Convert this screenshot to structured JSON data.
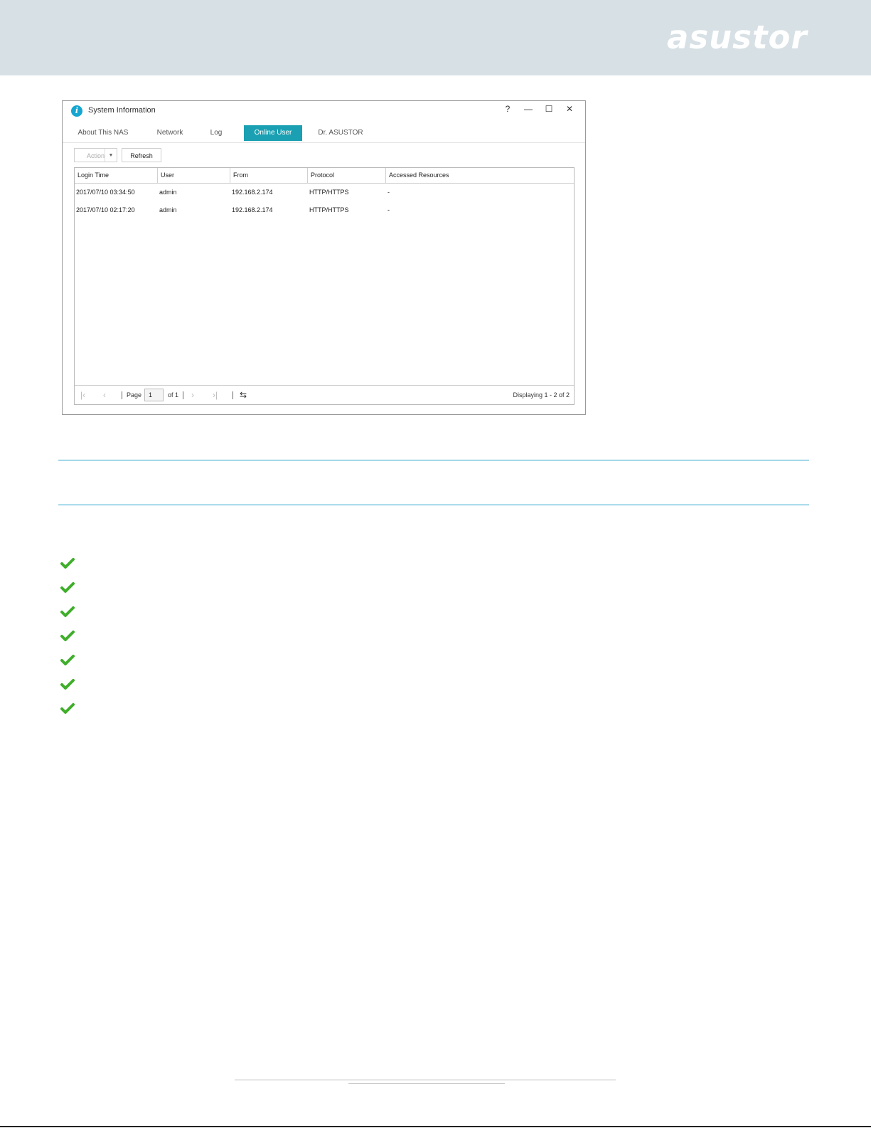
{
  "brand": {
    "logo_text": "asustor"
  },
  "window": {
    "title": "System Information",
    "controls": {
      "help": "?",
      "minimize": "—",
      "maximize": "☐",
      "close": "✕"
    },
    "tabs": [
      {
        "label": "About This NAS",
        "active": false
      },
      {
        "label": "Network",
        "active": false
      },
      {
        "label": "Log",
        "active": false
      },
      {
        "label": "Online User",
        "active": true
      },
      {
        "label": "Dr. ASUSTOR",
        "active": false
      }
    ],
    "toolbar": {
      "action_label": "Action",
      "refresh_label": "Refresh"
    },
    "table": {
      "columns": [
        "Login Time",
        "User",
        "From",
        "Protocol",
        "Accessed Resources"
      ],
      "rows": [
        [
          "2017/07/10 03:34:50",
          "admin",
          "192.168.2.174",
          "HTTP/HTTPS",
          "-"
        ],
        [
          "2017/07/10 02:17:20",
          "admin",
          "192.168.2.174",
          "HTTP/HTTPS",
          "-"
        ]
      ]
    },
    "pager": {
      "page_label": "Page",
      "page_value": "1",
      "of_label": "of 1",
      "displaying": "Displaying 1 - 2 of 2"
    }
  },
  "colors": {
    "accent": "#1aa0b2",
    "rule": "#2aa3c9",
    "check": "#3fae2a",
    "header_bg": "#d7e0e5"
  }
}
